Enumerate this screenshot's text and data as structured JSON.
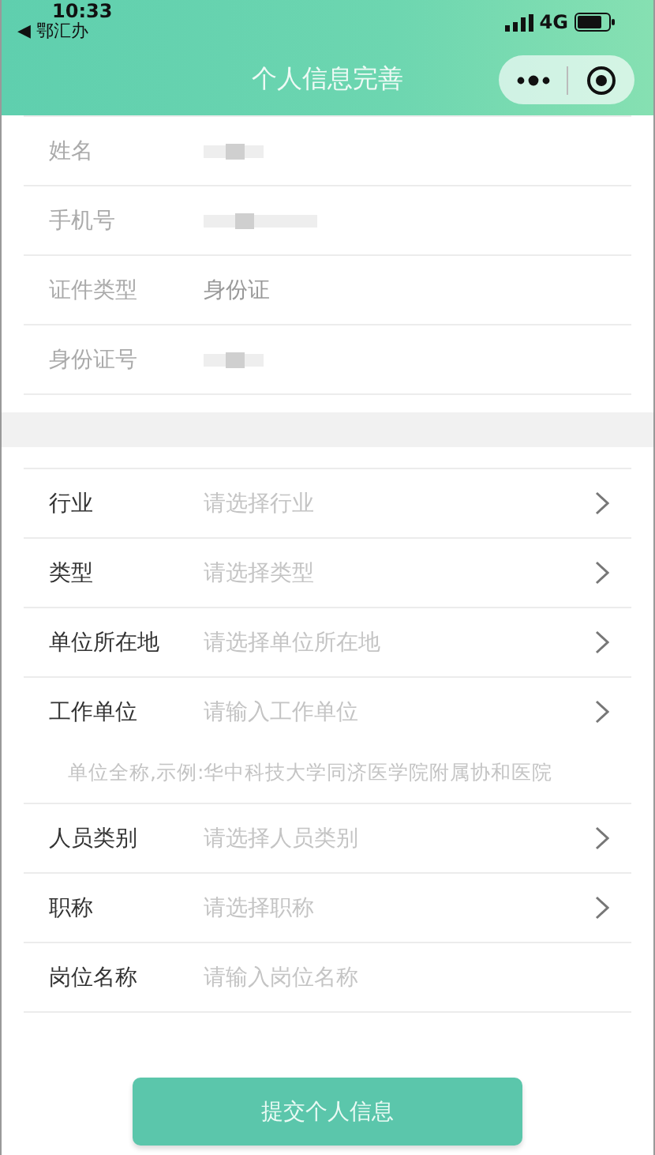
{
  "status_bar": {
    "time": "10:33",
    "back_app": "◀ 鄂汇办",
    "network": "4G"
  },
  "nav_bar": {
    "title": "个人信息完善"
  },
  "identity_fields": [
    {
      "label": "姓名",
      "masked": true
    },
    {
      "label": "手机号",
      "masked": true
    },
    {
      "label": "证件类型",
      "masked": false,
      "value": "身份证"
    },
    {
      "label": "身份证号",
      "masked": true
    }
  ],
  "work_fields": [
    {
      "label": "行业",
      "kind": "select",
      "placeholder": "请选择行业"
    },
    {
      "label": "类型",
      "kind": "select",
      "placeholder": "请选择类型"
    },
    {
      "label": "单位所在地",
      "kind": "select",
      "placeholder": "请选择单位所在地"
    },
    {
      "label": "工作单位",
      "kind": "select",
      "placeholder": "请输入工作单位",
      "hint": "单位全称,示例:华中科技大学同济医学院附属协和医院"
    },
    {
      "label": "人员类别",
      "kind": "select",
      "placeholder": "请选择人员类别"
    },
    {
      "label": "职称",
      "kind": "select",
      "placeholder": "请选择职称"
    },
    {
      "label": "岗位名称",
      "kind": "input",
      "placeholder": "请输入岗位名称"
    }
  ],
  "submit_button": "提交个人信息"
}
